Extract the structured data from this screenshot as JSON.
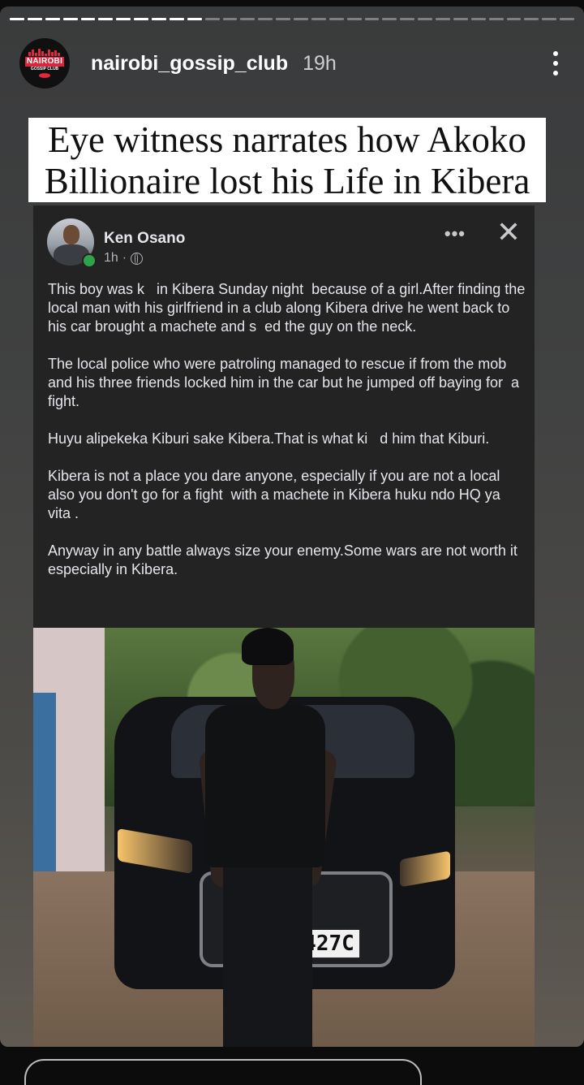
{
  "story": {
    "progress_segments": 32,
    "progress_completed": 11,
    "username": "nairobi_gossip_club",
    "time_ago": "19h",
    "avatar_logo": {
      "main": "NAIROBI",
      "sub": "GOSSIP CLUB"
    },
    "icons": {
      "more": "more-vertical-icon"
    }
  },
  "headline": {
    "line1": "Eye witness narrates how Akoko",
    "line2": "Billionaire lost his Life in Kibera"
  },
  "post": {
    "author": "Ken Osano",
    "time": "1h",
    "separator": "·",
    "icons": {
      "audience": "globe-icon",
      "options": "more-horizontal-icon",
      "close": "close-icon"
    },
    "paragraphs": [
      "This boy was k   in Kibera Sunday night  because of a girl.After finding the local man with his girlfriend in a club along Kibera drive he went back to his car brought a machete and s  ed the guy on the neck.",
      "The local police who were patroling managed to rescue if from the mob and his three friends locked him in the car but he jumped off baying for  a fight.",
      "Huyu alipekeka Kiburi sake Kibera.That is what ki   d him that Kiburi.",
      "Kibera is not a place you dare anyone, especially if you are not a local also you don't go for a fight  with a machete in Kibera huku ndo HQ ya vita .",
      "Anyway in any battle always size your enemy.Some wars are not worth it especially in Kibera."
    ]
  },
  "photo": {
    "plate": "427C"
  }
}
